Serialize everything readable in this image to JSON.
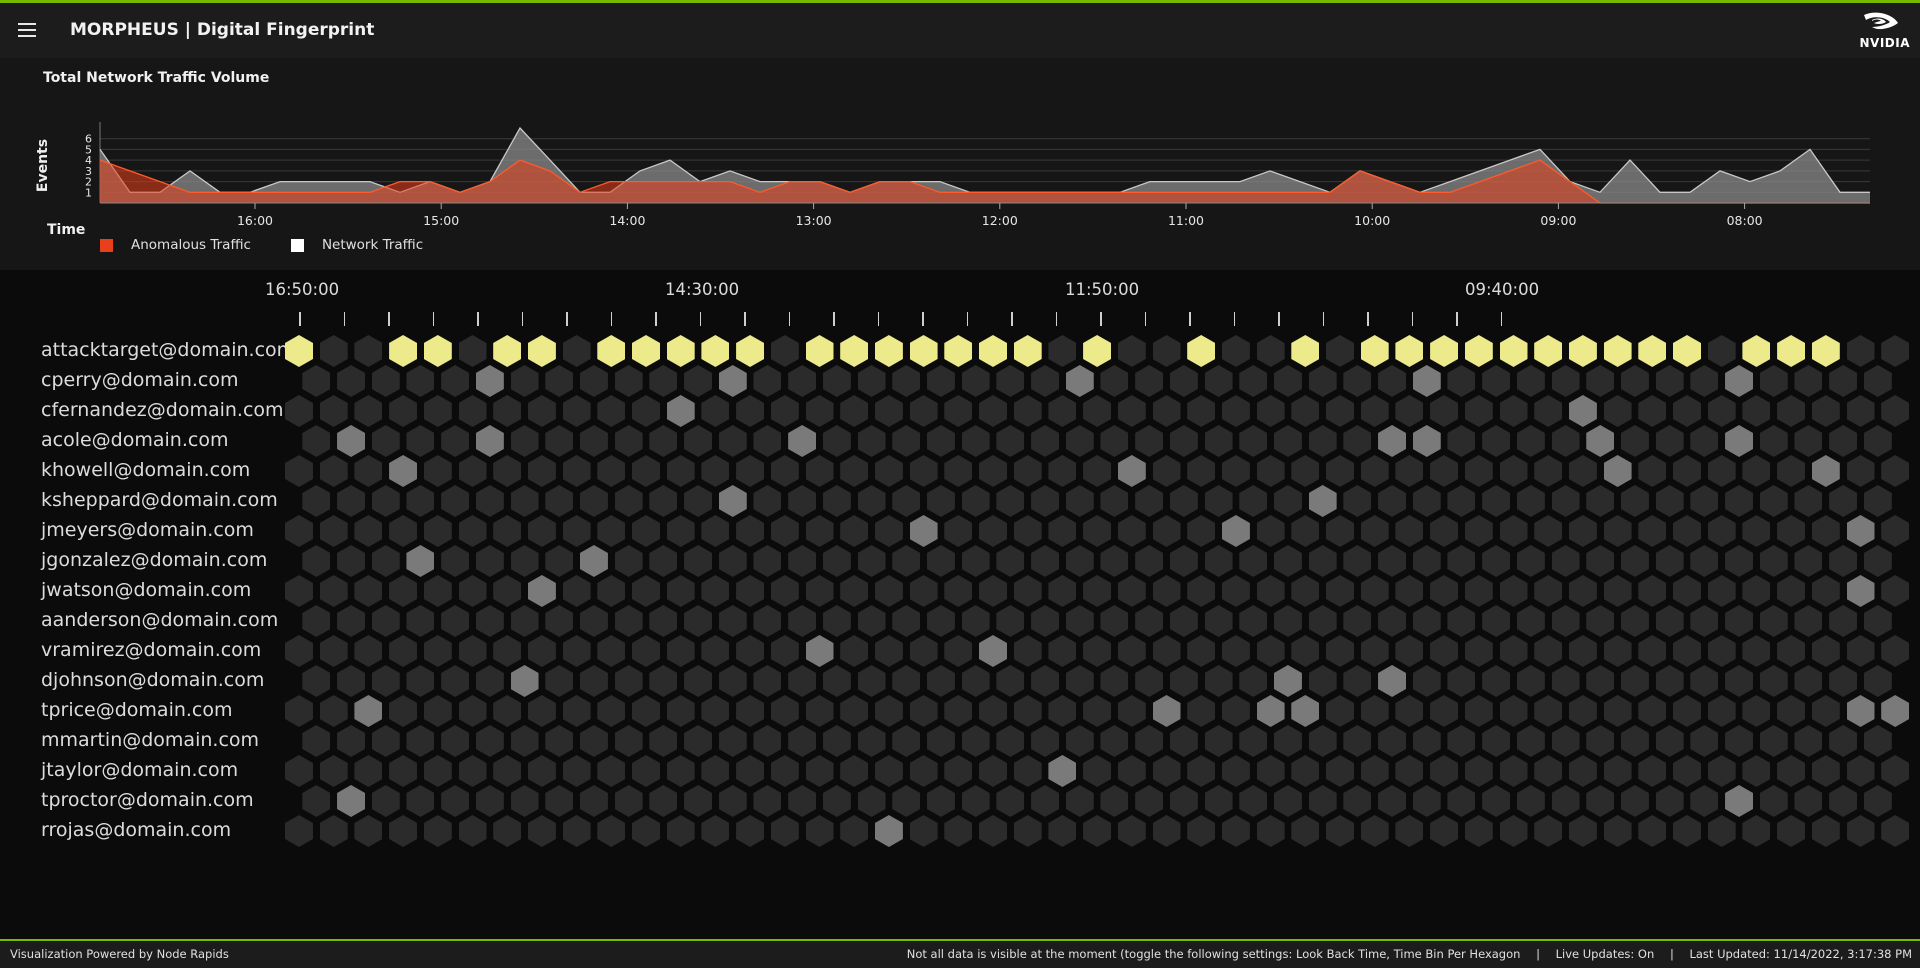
{
  "header": {
    "title": "MORPHEUS | Digital Fingerprint",
    "menu_icon": "hamburger-menu-icon",
    "logo_text": "NVIDIA"
  },
  "chart": {
    "panel_title": "Total Network Traffic Volume",
    "legend": [
      {
        "label": "Anomalous Traffic",
        "color": "#e8401c"
      },
      {
        "label": "Network Traffic",
        "color": "#ffffff"
      }
    ]
  },
  "chart_data": {
    "type": "area",
    "title": "Total Network Traffic Volume",
    "xlabel": "Time",
    "ylabel": "Events",
    "ylim": [
      0,
      7
    ],
    "y_ticks": [
      1,
      2,
      3,
      4,
      5,
      6
    ],
    "x_ticks": [
      "16:00",
      "15:00",
      "14:00",
      "13:00",
      "12:00",
      "11:00",
      "10:00",
      "09:00",
      "08:00"
    ],
    "x_axis_reversed": true,
    "legend_position": "bottom-left",
    "series": [
      {
        "name": "Network Traffic",
        "color": "#cfcfcf",
        "values": [
          5,
          1,
          1,
          3,
          1,
          1,
          2,
          2,
          2,
          2,
          1,
          2,
          1,
          2,
          7,
          4,
          1,
          1,
          3,
          4,
          2,
          3,
          2,
          2,
          2,
          1,
          2,
          2,
          2,
          1,
          1,
          1,
          1,
          1,
          1,
          2,
          2,
          2,
          2,
          3,
          2,
          1,
          3,
          2,
          1,
          2,
          3,
          4,
          5,
          2,
          1,
          4,
          1,
          1,
          3,
          2,
          3,
          5,
          1,
          1
        ]
      },
      {
        "name": "Anomalous Traffic",
        "color": "#e8401c",
        "values": [
          4,
          3,
          2,
          1,
          1,
          1,
          1,
          1,
          1,
          1,
          2,
          2,
          1,
          2,
          4,
          3,
          1,
          2,
          2,
          2,
          2,
          2,
          1,
          2,
          2,
          1,
          2,
          2,
          1,
          1,
          1,
          1,
          1,
          1,
          1,
          1,
          1,
          1,
          1,
          1,
          1,
          1,
          3,
          2,
          1,
          1,
          2,
          3,
          4,
          2,
          0,
          0,
          0,
          0,
          0,
          0,
          0,
          0,
          0,
          0
        ]
      }
    ]
  },
  "grid": {
    "time_labels": [
      "16:50:00",
      "14:30:00",
      "11:50:00",
      "09:40:00"
    ],
    "tick_count": 28,
    "columns": 47,
    "users": [
      "attacktarget@domain.com",
      "cperry@domain.com",
      "cfernandez@domain.com",
      "acole@domain.com",
      "khowell@domain.com",
      "ksheppard@domain.com",
      "jmeyers@domain.com",
      "jgonzalez@domain.com",
      "jwatson@domain.com",
      "aanderson@domain.com",
      "vramirez@domain.com",
      "djohnson@domain.com",
      "tprice@domain.com",
      "mmartin@domain.com",
      "jtaylor@domain.com",
      "tproctor@domain.com",
      "rrojas@domain.com"
    ],
    "colors": {
      "empty": "#2b2b2b",
      "event": "#7a7a7a",
      "anomalous": "#ecea8a"
    },
    "anomalous": [
      [
        0,
        [
          0,
          3,
          4,
          6,
          7,
          9,
          10,
          11,
          12,
          13,
          15,
          16,
          17,
          18,
          19,
          20,
          21,
          23,
          26,
          29,
          31,
          32,
          33,
          34,
          35,
          36,
          37,
          38,
          39,
          40,
          42,
          43,
          44
        ]
      ]
    ],
    "events": [
      [
        1,
        [
          5,
          12,
          22,
          32,
          41
        ]
      ],
      [
        2,
        [
          11,
          37
        ]
      ],
      [
        3,
        [
          1,
          5,
          14,
          31,
          32,
          37,
          41
        ]
      ],
      [
        4,
        [
          3,
          24,
          38,
          44
        ]
      ],
      [
        5,
        [
          12,
          29
        ]
      ],
      [
        6,
        [
          18,
          27,
          45
        ]
      ],
      [
        7,
        [
          3,
          8
        ]
      ],
      [
        8,
        [
          7,
          45
        ]
      ],
      [
        9,
        []
      ],
      [
        10,
        [
          15,
          20
        ]
      ],
      [
        11,
        [
          6,
          28,
          31
        ]
      ],
      [
        12,
        [
          2,
          25,
          28,
          29,
          45,
          46
        ]
      ],
      [
        13,
        [
          46
        ]
      ],
      [
        14,
        [
          22
        ]
      ],
      [
        15,
        [
          1,
          41
        ]
      ],
      [
        16,
        [
          17
        ]
      ]
    ]
  },
  "footer": {
    "left": "Visualization Powered by Node Rapids",
    "notice": "Not all data is visible at the moment (toggle the following settings: Look Back Time, Time Bin Per Hexagon",
    "live_updates": "Live Updates: On",
    "last_updated": "Last Updated: 11/14/2022, 3:17:38 PM"
  }
}
